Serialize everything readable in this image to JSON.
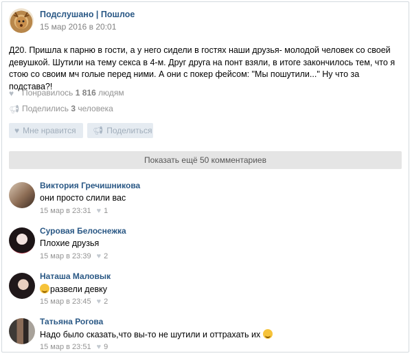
{
  "post": {
    "group_name": "Подслушано | Пошлое",
    "date": "15 мар 2016 в 20:01",
    "text": "Д20. Пришла к парню в гости, а у него сидели в гостях наши друзья- молодой человек со своей девушкой. Шутили на тему секса в 4-м. Друг друга на понт взяли, в итоге закончилось тем, что я стою со своим мч голые перед ними. А они с покер фейсом: \"Мы пошутили...\" Ну что за подстава?!",
    "likes_prefix": "Понравилось",
    "likes_count": "1 816",
    "likes_suffix": "людям",
    "shares_prefix": "Поделились",
    "shares_count": "3",
    "shares_suffix": "человека",
    "like_button": "Мне нравится",
    "share_button": "Поделиться",
    "more_comments": "Показать ещё 50 комментариев"
  },
  "comments": [
    {
      "author": "Виктория Гречишникова",
      "text": "они просто слили вас",
      "date": "15 мар в 23:31",
      "likes": "1"
    },
    {
      "author": "Суровая Белоснежка",
      "text": "Плохие друзья",
      "date": "15 мар в 23:39",
      "likes": "2"
    },
    {
      "author": "Наташа Маловык",
      "text": "развели девку",
      "date": "15 мар в 23:45",
      "likes": "2"
    },
    {
      "author": "Татьяна Рогова",
      "text": "Надо было сказать,что вы-то не шутили и оттрахать их",
      "date": "15 мар в 23:51",
      "likes": "9"
    }
  ],
  "icons": {
    "heart": "heart-icon",
    "megaphone": "megaphone-icon",
    "emoji": "laughing-emoji-icon",
    "smirk": "smirk-emoji-icon"
  },
  "colors": {
    "link": "#2a5885",
    "muted": "#939393",
    "button_bg": "#e5ebf1"
  }
}
